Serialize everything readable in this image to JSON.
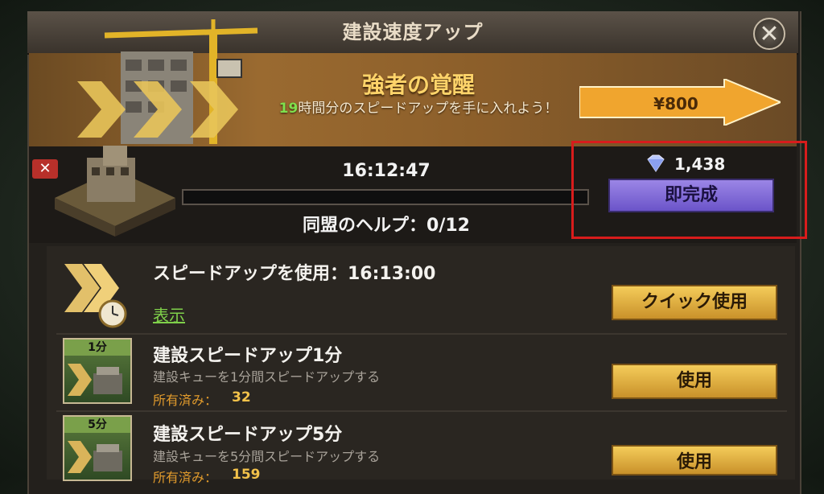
{
  "header": {
    "title": "建設速度アップ"
  },
  "banner": {
    "title": "強者の覚醒",
    "hours": "19",
    "subtitle_rest": "時間分のスピードアップを手に入れよう！",
    "price": "¥800"
  },
  "queue": {
    "timer": "16:12:47",
    "alliance_help": "同盟のヘルプ：0/12",
    "gems": "1,438",
    "instant_label": "即完成"
  },
  "items": [
    {
      "title": "スピードアップを使用：16:13:00",
      "link": "表示",
      "button": "クイック使用"
    },
    {
      "badge": "1分",
      "title": "建設スピードアップ1分",
      "desc": "建設キューを1分間スピードアップする",
      "owned_label": "所有済み：",
      "owned": "32",
      "button": "使用"
    },
    {
      "badge": "5分",
      "title": "建設スピードアップ5分",
      "desc": "建設キューを5分間スピードアップする",
      "owned_label": "所有済み：",
      "owned": "159",
      "button": "使用"
    }
  ]
}
